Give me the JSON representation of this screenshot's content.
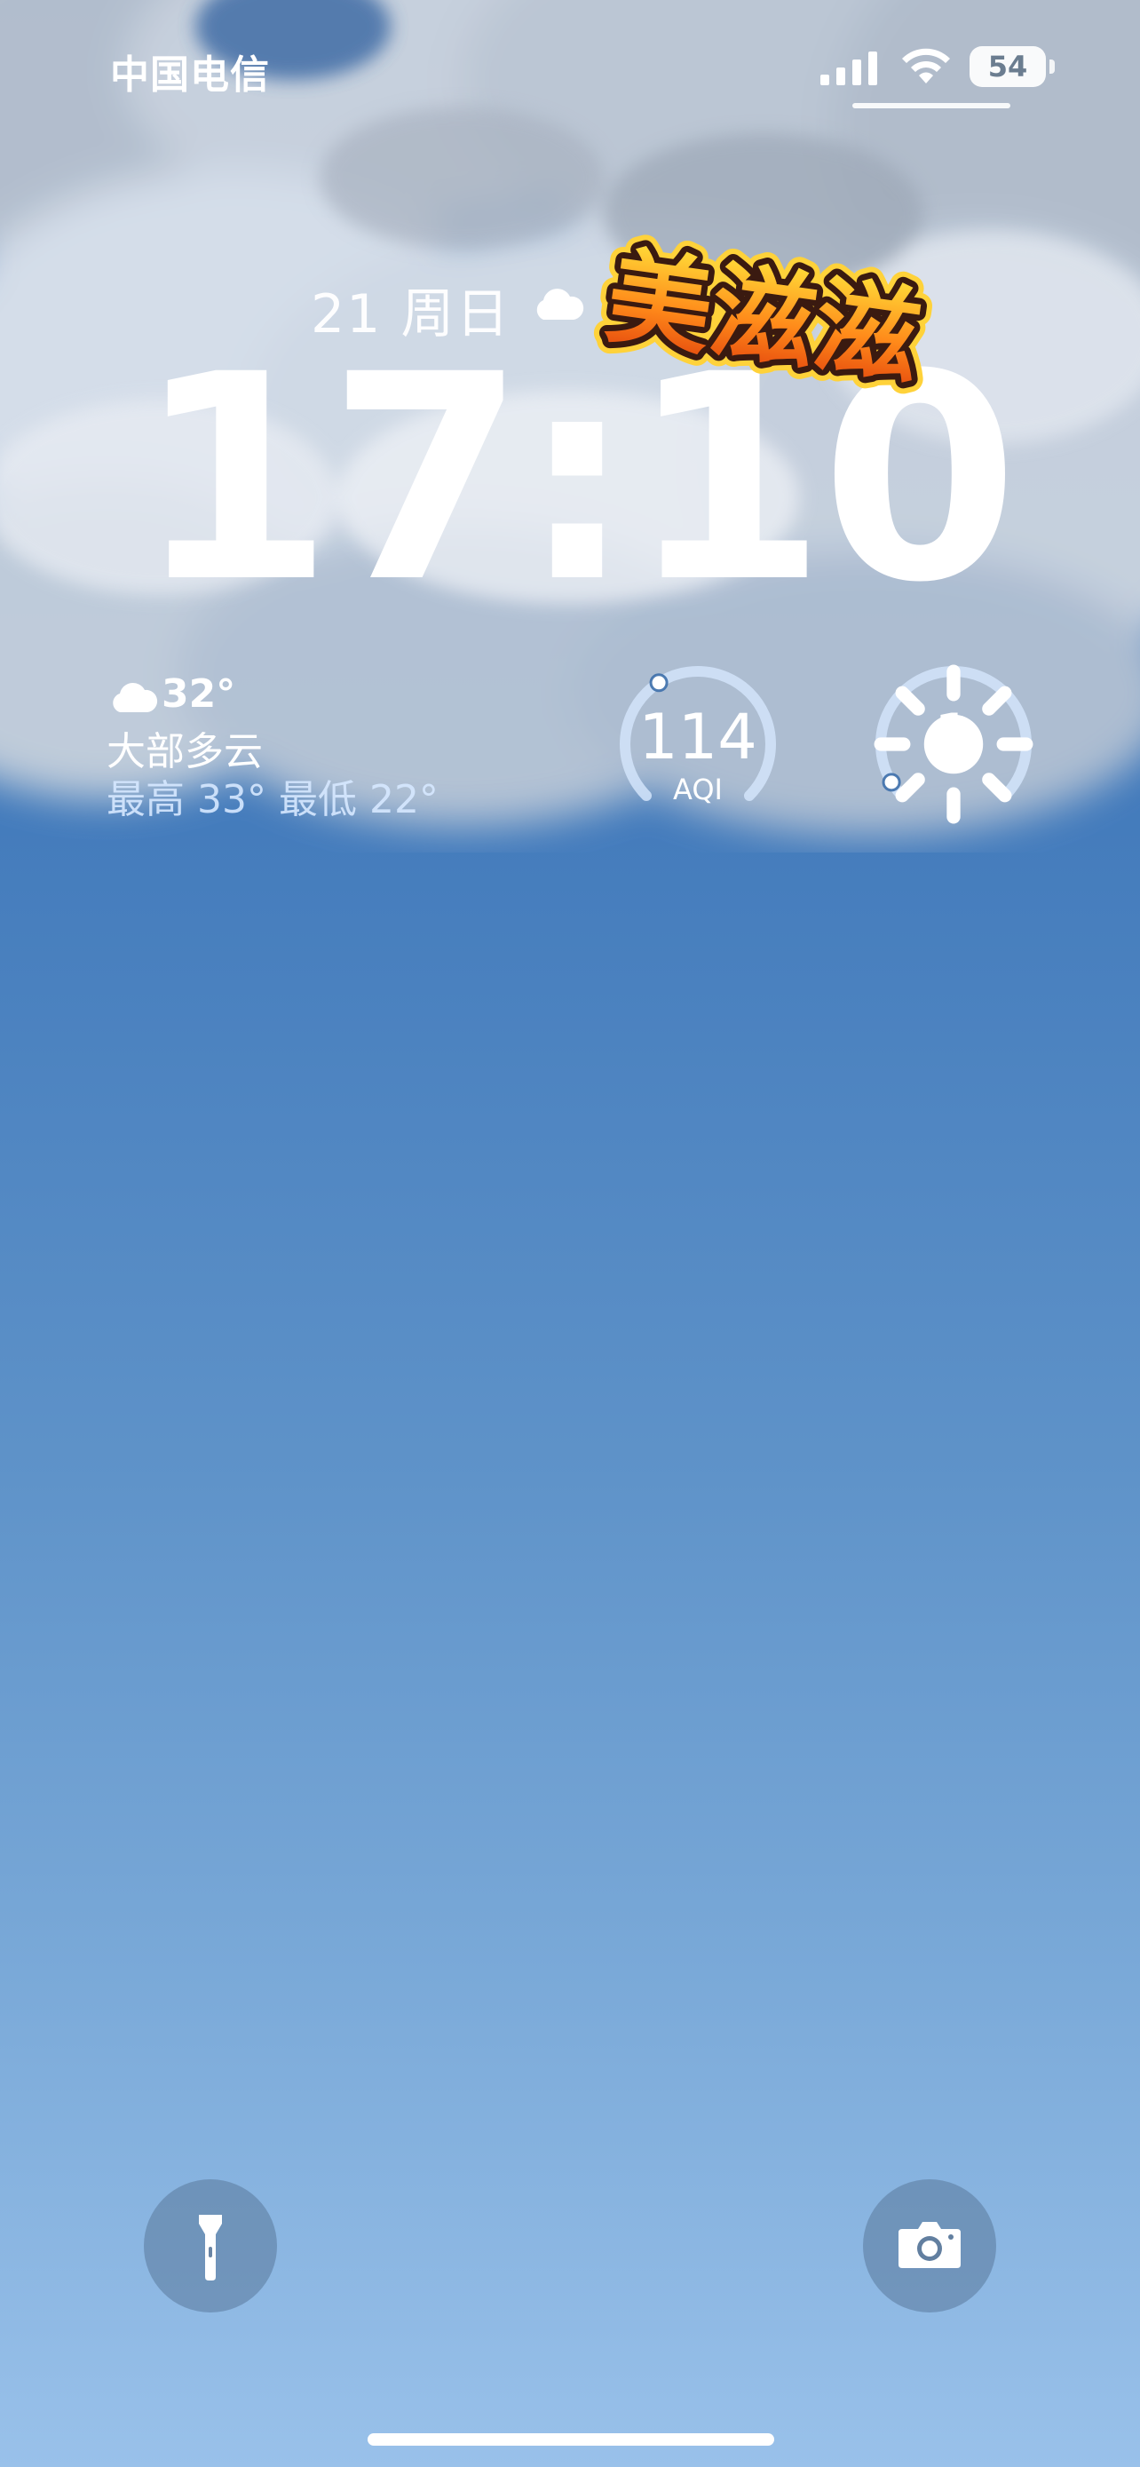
{
  "status_bar": {
    "carrier": "中国电信",
    "battery_level": "54",
    "signal_icon": "cellular-signal-icon",
    "wifi_icon": "wifi-icon"
  },
  "lock_screen": {
    "date": "21 周日",
    "date_weather_icon": "cloud-icon",
    "time": "17:10",
    "sticker": {
      "text": "美滋滋",
      "colors": {
        "fill_top": "#ffe23a",
        "fill_bottom": "#f06a12",
        "outline": "#3a1a10",
        "glow": "#ffd23a"
      }
    }
  },
  "weather": {
    "icon": "cloud-icon",
    "temperature": "32°",
    "condition": "大部多云",
    "high_low": "最高 33° 最低 22°"
  },
  "aqi_widget": {
    "value": "114",
    "label": "AQI",
    "level_fraction": 0.38
  },
  "uv_widget": {
    "value": "1",
    "icon": "sun-icon",
    "level_fraction": 0.05
  },
  "quick_actions": {
    "flashlight_icon": "flashlight-icon",
    "camera_icon": "camera-icon"
  },
  "colors": {
    "sky_top": "#2f6db1",
    "sky_bottom": "#99c1ea",
    "text": "#ffffff",
    "hilo_text": "#d6e8ff"
  }
}
